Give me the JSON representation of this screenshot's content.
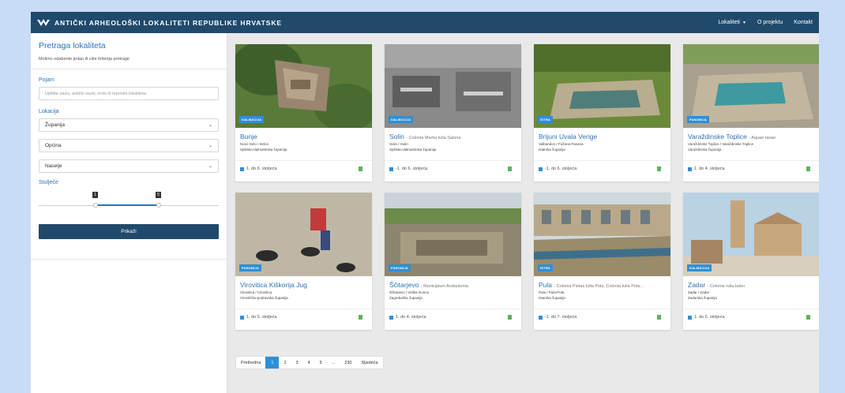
{
  "app": {
    "title": "ANTIČKI ARHEOLOŠKI LOKALITETI REPUBLIKE HRVATSKE",
    "nav": [
      {
        "label": "Lokaliteti",
        "icon": "caret-down-icon"
      },
      {
        "label": "O projektu"
      },
      {
        "label": "Kontakt"
      }
    ]
  },
  "sidebar": {
    "title": "Pretraga lokaliteta",
    "subtitle": "Molimo odaberite jedan ili više kriterija pretrage",
    "pojam_label": "Pojam",
    "pojam_placeholder": "Upišite naziv, antički naziv, vrstu ili toponim lokaliteta",
    "lokacija_label": "Lokacija",
    "selects": [
      "Županija",
      "Općina",
      "Naselje"
    ],
    "stoljece_label": "Stoljeće",
    "slider_min": "1",
    "slider_max": "5",
    "button": "Prikaži"
  },
  "cards": [
    {
      "title": "Bunje",
      "alt": "",
      "place": "Novo Selo / Selca",
      "county": "Splitsko-dalmatinska županija",
      "region": "DALMACIJA",
      "date": "1. do 6. stoljeća"
    },
    {
      "title": "Solin",
      "alt": "- Colonia Martia Iulia Salona",
      "place": "Solin / Solin",
      "county": "Splitsko-dalmatinska županija",
      "region": "DALMACIJA",
      "date": "-1. do 6. stoljeća"
    },
    {
      "title": "Brijuni Uvala Verige",
      "alt": "",
      "place": "Valbandon / Fažana-Fasana",
      "county": "Istarska županija",
      "region": "ISTRA",
      "date": "-1. do 6. stoljeća"
    },
    {
      "title": "Varaždinske Toplice",
      "alt": "- Aquae Iasae",
      "place": "Varaždinske Toplice / Varaždinske Toplice",
      "county": "Varaždinska županija",
      "region": "PANONIJA",
      "date": "1. do 4. stoljeća"
    },
    {
      "title": "Virovitica Kiškorija Jug",
      "alt": "",
      "place": "Virovitica / Virovitica",
      "county": "Virovitičko-podravska županija",
      "region": "PANONIJA",
      "date": "1. do 5. stoljeća"
    },
    {
      "title": "Ščitarjevo",
      "alt": "- Municipium Andautonia",
      "place": "Ščitarjevo / Velika Gorica",
      "county": "Zagrebačka županija",
      "region": "PANONIJA",
      "date": "1. do 4. stoljeća"
    },
    {
      "title": "Pula",
      "alt": "- Colonia Pietas Iulia Pola; Colonia Iulia Pola...",
      "place": "Pula / Pula-Pola",
      "county": "Istarska županija",
      "region": "ISTRA",
      "date": "-1. do 7. stoljeća"
    },
    {
      "title": "Zadar",
      "alt": "- Colonia Iulia Iader",
      "place": "Zadar / Zadar",
      "county": "Zadarska županija",
      "region": "DALMACIJA",
      "date": "1. do 6. stoljeća"
    }
  ],
  "pagination": [
    "Prethodna",
    "1",
    "2",
    "3",
    "4",
    "5",
    "...",
    "230",
    "Sljedeća"
  ],
  "colors": {
    "navbar": "#1f4a6c",
    "accent": "#2d74b8",
    "badge": "#2f8fd6",
    "trash": "#5bb55b"
  }
}
